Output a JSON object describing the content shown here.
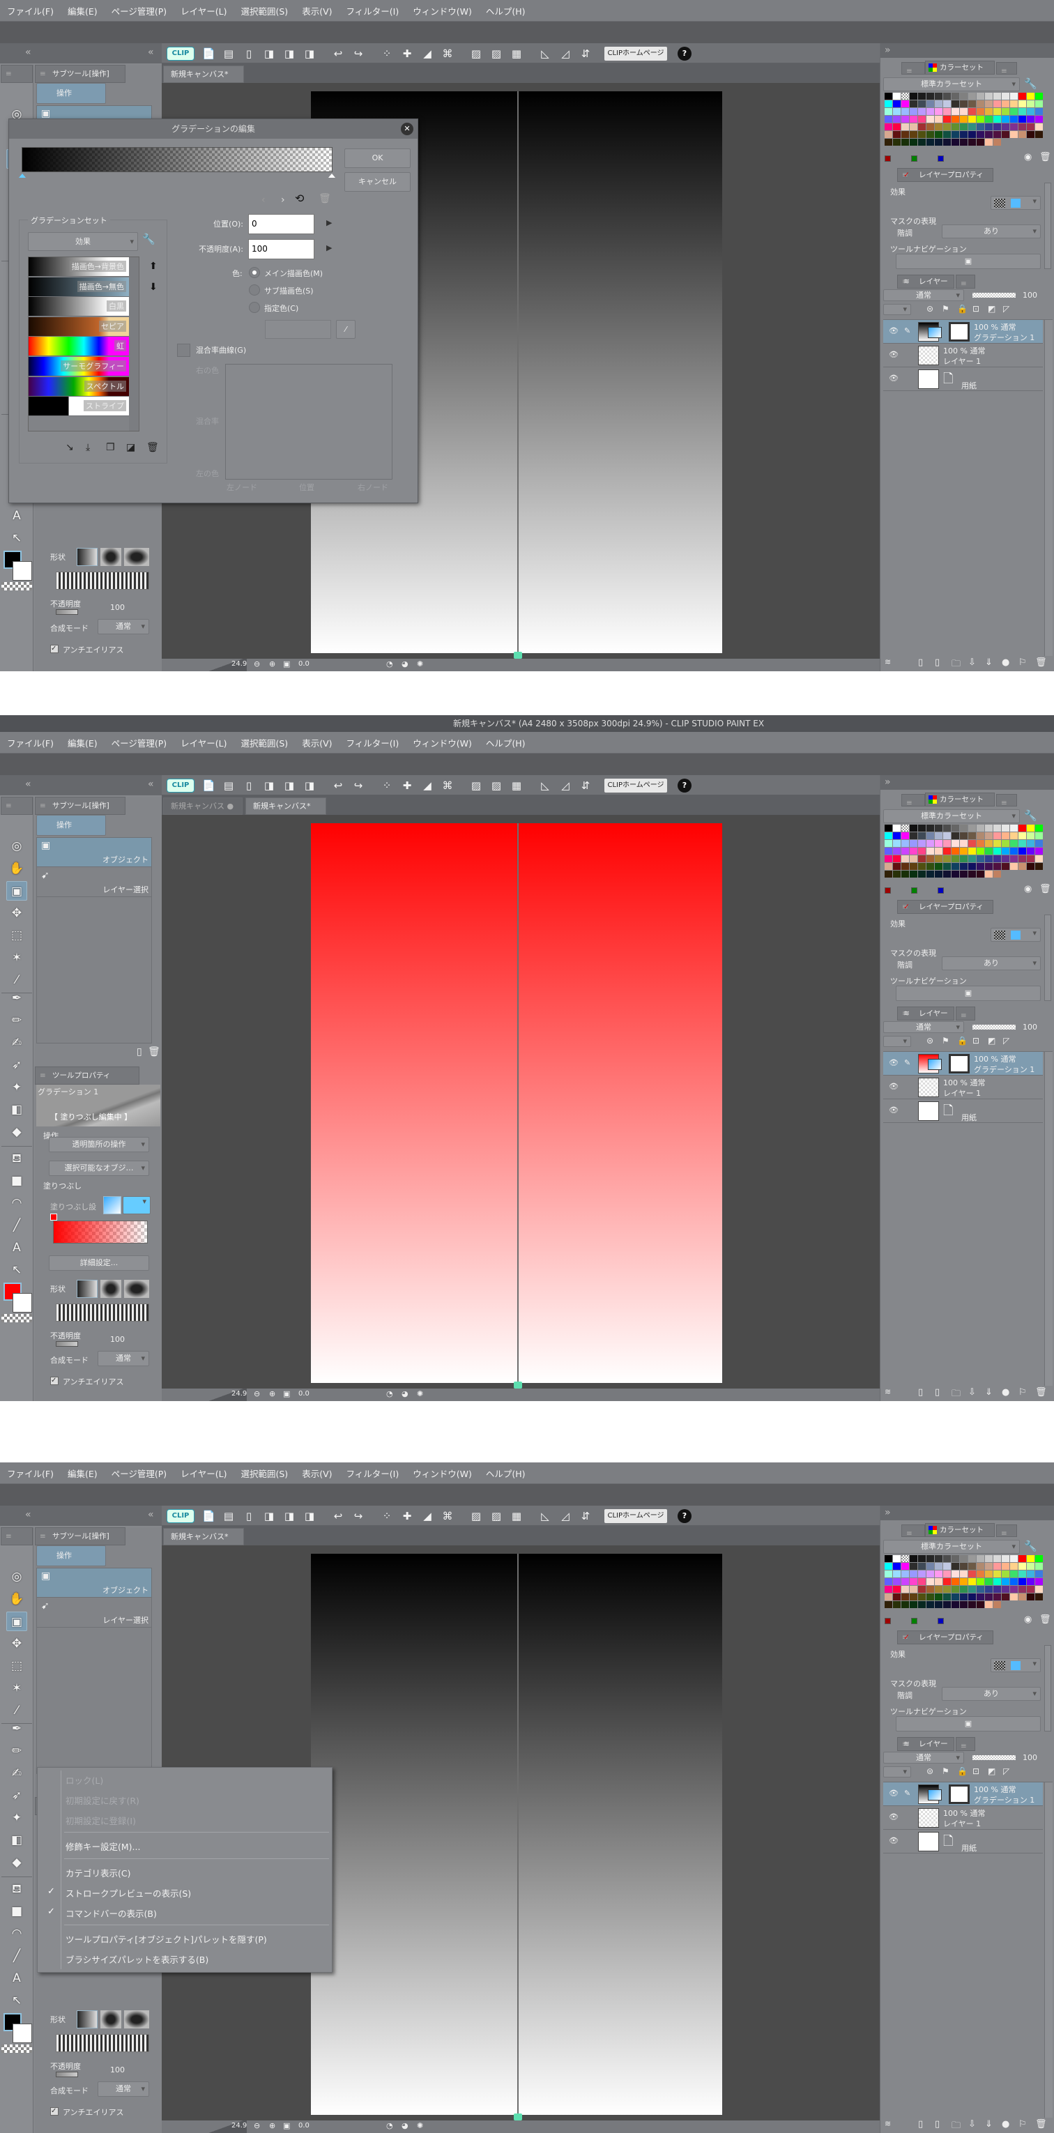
{
  "app": {
    "title": "新規キャンバス* (A4 2480 x 3508px 300dpi 24.9%) - CLIP STUDIO PAINT EX"
  },
  "menu": [
    "ファイル(F)",
    "編集(E)",
    "ページ管理(P)",
    "レイヤー(L)",
    "選択範囲(S)",
    "表示(V)",
    "フィルター(I)",
    "ウィンドウ(W)",
    "ヘルプ(H)"
  ],
  "toolbar": {
    "clip_logo": "CLIP",
    "home_button": "CLIPホームページ",
    "help": "?"
  },
  "left": {
    "subtool_tab": "サブツール[操作]",
    "group": "操作",
    "items": [
      "オブジェクト",
      "レイヤー選択"
    ],
    "toolprop_tab": "ツールプロパティ",
    "shape_label": "形状",
    "opacity_label": "不透明度",
    "opacity_value": "100",
    "blend_label": "合成モード",
    "blend_value": "通常",
    "antialias": "アンチエイリアス"
  },
  "fill_edit": {
    "layer_name": "グラデーション 1",
    "editing": "【 塗りつぶし編集中 】",
    "operation_label": "操作",
    "operation_value": "透明箇所の操作",
    "select_value": "選択可能なオブジ…",
    "fill_section": "塗りつぶし",
    "fill_setting_label": "塗りつぶし設",
    "detail_button": "詳細設定..."
  },
  "right": {
    "color_tab": "カラーセット",
    "color_set": "標準カラーセット",
    "palette": [
      [
        "#000000",
        "#ffffff",
        "checker",
        "#111111",
        "#1c1c1c",
        "#262626",
        "#333333",
        "#4d4d4d",
        "#666666",
        "#808080",
        "#999999",
        "#b3b3b3",
        "#cccccc",
        "#d9d9d9",
        "#e6e6e6",
        "#f2f2f2",
        "#ff0000",
        "#ffff00",
        "#00ff00"
      ],
      [
        "#00ffff",
        "#0000ff",
        "#ff00ff",
        "#2d2d2d",
        "#3f4a57",
        "#7384a8",
        "#a7b2cf",
        "#c1c8e2",
        "#332f2a",
        "#524539",
        "#6d5a46",
        "#b08a70",
        "#c9a08a",
        "#ff9999",
        "#ffb38a",
        "#ffd18a",
        "#ffff99",
        "#ccff99",
        "#99ff99"
      ],
      [
        "#99ffdd",
        "#99ddff",
        "#99bbff",
        "#9999ff",
        "#bb99ff",
        "#dd99ff",
        "#ff99ee",
        "#ff99bb",
        "#ffe0dd",
        "#ffd9d0",
        "#e84a4a",
        "#e87c3c",
        "#e8b23c",
        "#e0e03c",
        "#a0e03c",
        "#3ce06a",
        "#3ce0c0",
        "#3cb4e0",
        "#3c7ce0"
      ],
      [
        "#6060ff",
        "#9c4cff",
        "#cc44ff",
        "#ff44cc",
        "#ff4488",
        "#ffe0d4",
        "#ffd4c0",
        "#ff2020",
        "#ff6600",
        "#ffaa00",
        "#ffee00",
        "#88ff00",
        "#22dd44",
        "#00ffcc",
        "#00aaff",
        "#0066ff",
        "#0000ff",
        "#6600ff",
        "#aa00ff"
      ],
      [
        "#ff0088",
        "#ff0044",
        "#f0d0c0",
        "#e8c0a8",
        "#a03030",
        "#a06030",
        "#a08030",
        "#909030",
        "#609030",
        "#309050",
        "#309080",
        "#306090",
        "#304090",
        "#403090",
        "#603090",
        "#803090",
        "#903060",
        "#a03050",
        "#ffd8c0"
      ],
      [
        "#d8a890",
        "#601010",
        "#603010",
        "#604010",
        "#505010",
        "#305010",
        "#105010",
        "#105040",
        "#104060",
        "#102060",
        "#101060",
        "#301060",
        "#401050",
        "#501040",
        "#501020",
        "#ffc8a8",
        "#c89070",
        "#300808",
        "#301808"
      ],
      [
        "#302008",
        "#283008",
        "#183008",
        "#083010",
        "#082820",
        "#082030",
        "#081830",
        "#101030",
        "#180830",
        "#200828",
        "#280820",
        "#300818",
        "#ffc0a0",
        "#c08060"
      ]
    ],
    "recent_colors": [
      "#a00000",
      "#008000",
      "#0000c0"
    ],
    "layer_prop_tab": "レイヤープロパティ",
    "effect_label": "効果",
    "mask_label": "マスクの表現",
    "gradation_label": "階調",
    "gradation_value": "あり",
    "tool_nav": "ツールナビゲーション",
    "layer_tab": "レイヤー",
    "blend": "通常",
    "opacity": "100",
    "layers": [
      {
        "info": "100 % 通常",
        "name": "グラデーション 1"
      },
      {
        "info": "100 % 通常",
        "name": "レイヤー 1"
      },
      {
        "info": "",
        "name": "用紙"
      }
    ]
  },
  "status": {
    "zoom": "24.9",
    "rotation": "0.0"
  },
  "windows": [
    {
      "tabs": [
        {
          "label": "新規キャンバス*"
        }
      ],
      "gradient_color": "#000000",
      "main_color": "#000000"
    },
    {
      "tabs": [
        {
          "label": "新規キャンバス"
        },
        {
          "label": "新規キャンバス*"
        }
      ],
      "gradient_color": "#ff0000",
      "main_color": "#ff0000"
    },
    {
      "tabs": [
        {
          "label": "新規キャンバス*"
        }
      ],
      "gradient_color": "#000000",
      "main_color": "#000000"
    }
  ],
  "dialog": {
    "title": "グラデーションの編集",
    "ok": "OK",
    "cancel": "キャンセル",
    "set_label": "グラデーションセット",
    "set_value": "効果",
    "items": [
      "描画色→背景色",
      "描画色→無色",
      "白黒",
      "セピア",
      "虹",
      "サーモグラフィー",
      "スペクトル",
      "ストライプ"
    ],
    "position_label": "位置(O):",
    "position_value": "0",
    "opacity_label": "不透明度(A):",
    "opacity_value": "100",
    "color_label": "色:",
    "radios": [
      "メイン描画色(M)",
      "サブ描画色(S)",
      "指定色(C)"
    ],
    "curve_label": "混合率曲線(G)",
    "graph_right_color": "右の色",
    "graph_ratio": "混合率",
    "graph_left_color": "左の色",
    "graph_left_node": "左ノード",
    "graph_position": "位置",
    "graph_right_node": "右ノード"
  },
  "context_menu": {
    "items": [
      {
        "label": "ロック(L)",
        "disabled": true,
        "checked": false
      },
      {
        "label": "初期設定に戻す(R)",
        "disabled": true,
        "checked": false
      },
      {
        "label": "初期設定に登録(I)",
        "disabled": true,
        "checked": false
      },
      {
        "label": "修飾キー設定(M)...",
        "disabled": false,
        "checked": false
      },
      {
        "label": "カテゴリ表示(C)",
        "disabled": false,
        "checked": false
      },
      {
        "label": "ストロークプレビューの表示(S)",
        "disabled": false,
        "checked": true
      },
      {
        "label": "コマンドバーの表示(B)",
        "disabled": false,
        "checked": true
      },
      {
        "label": "ツールプロパティ[オブジェクト]パレットを隠す(P)",
        "disabled": false,
        "checked": false
      },
      {
        "label": "ブラシサイズパレットを表示する(B)",
        "disabled": false,
        "checked": false
      }
    ]
  }
}
